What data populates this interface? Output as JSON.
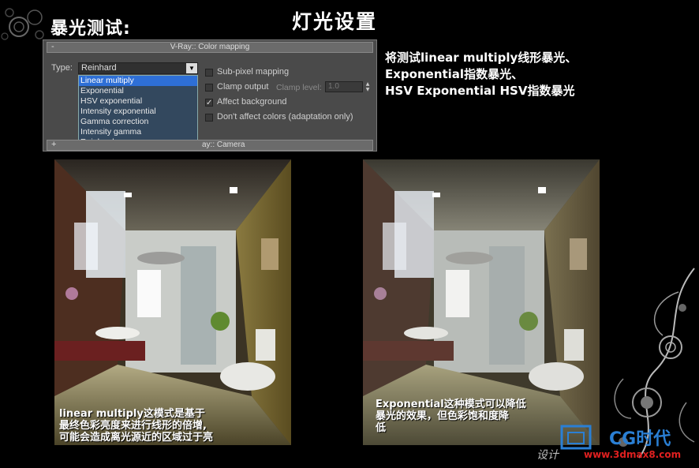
{
  "header": {
    "page_title": "灯光设置",
    "section_title": "暴光测试:"
  },
  "vray_panel": {
    "rollout_title": "V-Ray:: Color mapping",
    "collapse_sign": "-",
    "type_label": "Type:",
    "type_selected": "Reinhard",
    "type_options": [
      "Linear multiply",
      "Exponential",
      "HSV exponential",
      "Intensity exponential",
      "Gamma correction",
      "Intensity gamma",
      "Reinhard"
    ],
    "highlighted_option": "Linear multiply",
    "sub_pixel_label": "Sub-pixel mapping",
    "clamp_output_label": "Clamp output",
    "clamp_level_label": "Clamp level:",
    "clamp_level_value": "1.0",
    "affect_background_label": "Affect background",
    "dont_affect_label": "Don't affect colors (adaptation only)",
    "checkmark": "✓",
    "second_rollout_sign": "+",
    "second_rollout_title": "V-Ray:: Camera",
    "second_rollout_visible_title": "ay:: Camera"
  },
  "info_text": {
    "line1": "将测试linear multiply线形暴光、",
    "line2": "Exponential指数暴光、",
    "line3": "HSV Exponential HSV指数暴光"
  },
  "left_render": {
    "caption_line1": "linear multiply这模式是基于",
    "caption_line2": "最终色彩亮度来进行线形的倍增,",
    "caption_line3": "可能会造成离光源近的区域过于亮"
  },
  "right_render": {
    "caption_line1": "Exponential这种模式可以降低",
    "caption_line2": "暴光的效果，但色彩饱和度降",
    "caption_line3": "低"
  },
  "watermark": {
    "brand": "CG时代",
    "url": "www.3dmax8.com",
    "tagline": "设计"
  },
  "colors": {
    "panel_bg": "#4a4a4a",
    "dropdown_bg": "#33485e",
    "highlight": "#2e6fd6",
    "watermark_red": "#e02020",
    "watermark_blue": "#2a7fd4"
  }
}
